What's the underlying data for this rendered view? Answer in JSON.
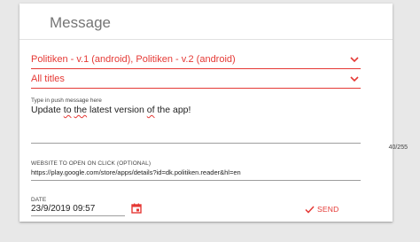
{
  "card": {
    "title": "Message"
  },
  "app_select": {
    "value": "Politiken - v.1 (android), Politiken - v.2 (android)"
  },
  "titles_select": {
    "value": "All titles"
  },
  "push_message": {
    "label": "Type in push message here",
    "value_parts": [
      "Update ",
      "to",
      " ",
      "the",
      " latest version ",
      "of",
      " the app!"
    ],
    "counter": "40/255"
  },
  "website": {
    "label": "Website to open on click (optional)",
    "value": "https://play.google.com/store/apps/details?id=dk.politiken.reader&hl=en"
  },
  "date": {
    "label": "Date",
    "value": "23/9/2019 09:57"
  },
  "send": {
    "label": "SEND"
  },
  "colors": {
    "accent": "#e53935",
    "text": "#222222",
    "muted": "#757575"
  },
  "icons": {
    "dropdown": "chevron-down-icon",
    "calendar": "calendar-icon",
    "send": "checkmark-icon"
  }
}
